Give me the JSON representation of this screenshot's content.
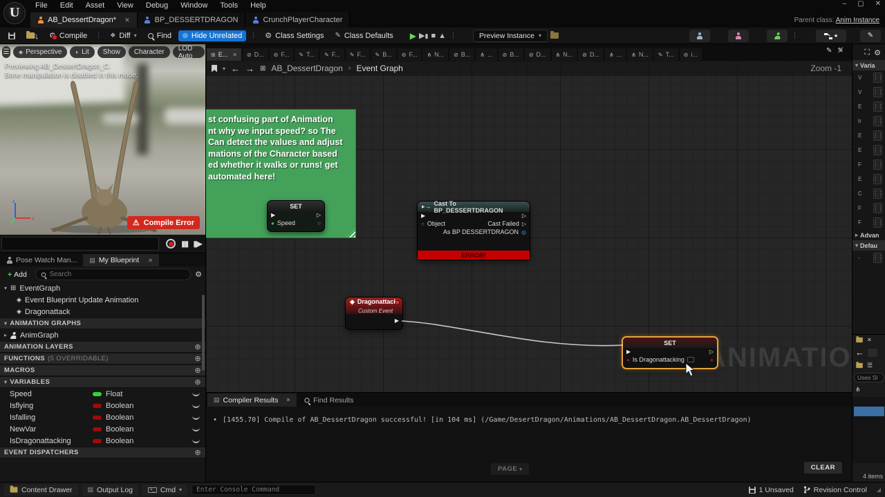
{
  "colors": {
    "accent_blue": "#1673d2",
    "selection_orange": "#e8a33d",
    "comment_green": "#44a15a",
    "error_red": "#c40000",
    "compile_badge_red": "#d3281e",
    "float_green": "#35d435",
    "boolean_red": "#9e0b0b",
    "play_green": "#5fd75f"
  },
  "menubar": {
    "items": [
      "File",
      "Edit",
      "Asset",
      "View",
      "Debug",
      "Window",
      "Tools",
      "Help"
    ]
  },
  "titlebar": {
    "parent_class_label": "Parent class:",
    "parent_class_value": "Anim Instance"
  },
  "asset_tabs": {
    "tab1": "AB_DessertDragon*",
    "tab2": "BP_DESSERTDRAGON",
    "tab3": "CrunchPlayerCharacter"
  },
  "toolbar": {
    "compile": "Compile",
    "diff": "Diff",
    "find": "Find",
    "hide_unrelated": "Hide Unrelated",
    "class_settings": "Class Settings",
    "class_defaults": "Class Defaults",
    "preview_instance": "Preview Instance"
  },
  "viewport": {
    "pill_perspective": "Perspective",
    "pill_lit": "Lit",
    "pill_show": "Show",
    "pill_character": "Character",
    "pill_lod": "LOD Auto",
    "overlay_line1": "Previewing AB_DessertDragon_C.",
    "overlay_line2": "Bone manipulation is disabled in this mode.",
    "compile_error": "Compile Error",
    "axis_x": "x",
    "axis_z": "z"
  },
  "left_panel": {
    "tab_pose_watch": "Pose Watch Man...",
    "tab_my_blueprint": "My Blueprint",
    "add_label": "Add",
    "search_placeholder": "Search",
    "eventgraph_label": "EventGraph",
    "event1": "Event Blueprint Update Animation",
    "event2": "Dragonattack",
    "sec_animation_graphs": "ANIMATION GRAPHS",
    "animgraph": "AnimGraph",
    "sec_animation_layers": "ANIMATION LAYERS",
    "sec_functions": "FUNCTIONS",
    "sec_functions_suffix": "(5 OVERRIDABLE)",
    "sec_macros": "MACROS",
    "sec_variables": "VARIABLES",
    "variables": [
      {
        "name": "Speed",
        "type": "Float"
      },
      {
        "name": "Isflying",
        "type": "Boolean"
      },
      {
        "name": "Isfalling",
        "type": "Boolean"
      },
      {
        "name": "NewVar",
        "type": "Boolean"
      },
      {
        "name": "IsDragonattacking",
        "type": "Boolean"
      }
    ],
    "sec_event_dispatchers": "EVENT DISPATCHERS"
  },
  "graph": {
    "doc_tabs": [
      {
        "icon": "graph",
        "label": "E...",
        "active": true
      },
      {
        "icon": "anim",
        "label": "D..."
      },
      {
        "icon": "anim",
        "label": "F..."
      },
      {
        "icon": "pen",
        "label": "T..."
      },
      {
        "icon": "pen",
        "label": "F..."
      },
      {
        "icon": "pen",
        "label": "F..."
      },
      {
        "icon": "pen",
        "label": "B..."
      },
      {
        "icon": "anim",
        "label": "F..."
      },
      {
        "icon": "tree",
        "label": "N..."
      },
      {
        "icon": "anim",
        "label": "B..."
      },
      {
        "icon": "tree",
        "label": "..."
      },
      {
        "icon": "anim",
        "label": "B..."
      },
      {
        "icon": "anim",
        "label": "D..."
      },
      {
        "icon": "tree",
        "label": "N..."
      },
      {
        "icon": "anim",
        "label": "D..."
      },
      {
        "icon": "tree",
        "label": "..."
      },
      {
        "icon": "tree",
        "label": "N..."
      },
      {
        "icon": "pen",
        "label": "T..."
      },
      {
        "icon": "anim",
        "label": "i..."
      }
    ],
    "breadcrumb_asset": "AB_DessertDragon",
    "breadcrumb_sep": "›",
    "breadcrumb_graph": "Event Graph",
    "zoom_label": "Zoom -1",
    "comment_lines": [
      "st confusing part of Animation",
      "nt why we input speed? so The",
      "Can detect the values and adjust",
      "mations of the Character based",
      "ed whether it walks or runs! get",
      "automated here!"
    ],
    "node_set_speed": {
      "title": "SET",
      "pin": "Speed"
    },
    "node_cast": {
      "title": "Cast To BP_DESSERTDRAGON",
      "pin_object": "Object",
      "pin_cast_failed": "Cast Failed",
      "pin_as": "As BP DESSERTDRAGON",
      "error": "ERROR!"
    },
    "node_event": {
      "title": "Dragonattack",
      "subtitle": "Custom Event"
    },
    "node_set_attack": {
      "title": "SET",
      "pin": "Is Dragonattacking"
    },
    "watermark": "ANIMATION"
  },
  "compiler": {
    "tab_results": "Compiler Results",
    "tab_find": "Find Results",
    "log_bullet": "•",
    "log": "[1455.70] Compile of AB_DessertDragon successful! [in 104 ms] (/Game/DesertDragon/Animations/AB_DessertDragon.AB_DessertDragon)",
    "page_button": "PAGE",
    "clear_button": "CLEAR"
  },
  "right_panel": {
    "sec_variables": "Varia",
    "icon_rows": [
      "V",
      "V",
      "E",
      "Ir",
      "E",
      "E",
      "F",
      "E",
      "C",
      "F",
      "F"
    ],
    "sec_advanced": "Advan",
    "sec_default": "Defau",
    "dash_row": "-",
    "uses_filter": "Uses Sl",
    "items_count": "4 items"
  },
  "statusbar": {
    "content_drawer": "Content Drawer",
    "output_log": "Output Log",
    "cmd": "Cmd",
    "console_placeholder": "Enter Console Command",
    "unsaved": "1 Unsaved",
    "revision_control": "Revision Control"
  }
}
